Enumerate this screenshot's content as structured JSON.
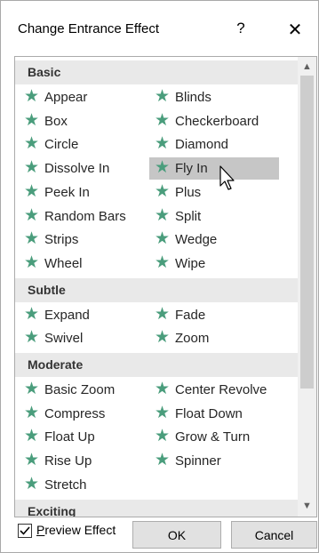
{
  "dialog": {
    "title": "Change Entrance Effect",
    "help_glyph": "?",
    "close_glyph": "✕"
  },
  "groups": [
    {
      "name": "Basic",
      "items": [
        "Appear",
        "Blinds",
        "Box",
        "Checkerboard",
        "Circle",
        "Diamond",
        "Dissolve In",
        "Fly In",
        "Peek In",
        "Plus",
        "Random Bars",
        "Split",
        "Strips",
        "Wedge",
        "Wheel",
        "Wipe"
      ]
    },
    {
      "name": "Subtle",
      "items": [
        "Expand",
        "Fade",
        "Swivel",
        "Zoom"
      ]
    },
    {
      "name": "Moderate",
      "items": [
        "Basic Zoom",
        "Center Revolve",
        "Compress",
        "Float Down",
        "Float Up",
        "Grow & Turn",
        "Rise Up",
        "Spinner",
        "Stretch"
      ]
    },
    {
      "name": "Exciting",
      "items": []
    }
  ],
  "selected_item": "Fly In",
  "star_glyph": "★",
  "icon_color": "#4a9d7c",
  "footer": {
    "preview_prefix": "P",
    "preview_rest": "review Effect",
    "preview_checked": true,
    "ok_label": "OK",
    "cancel_label": "Cancel"
  }
}
